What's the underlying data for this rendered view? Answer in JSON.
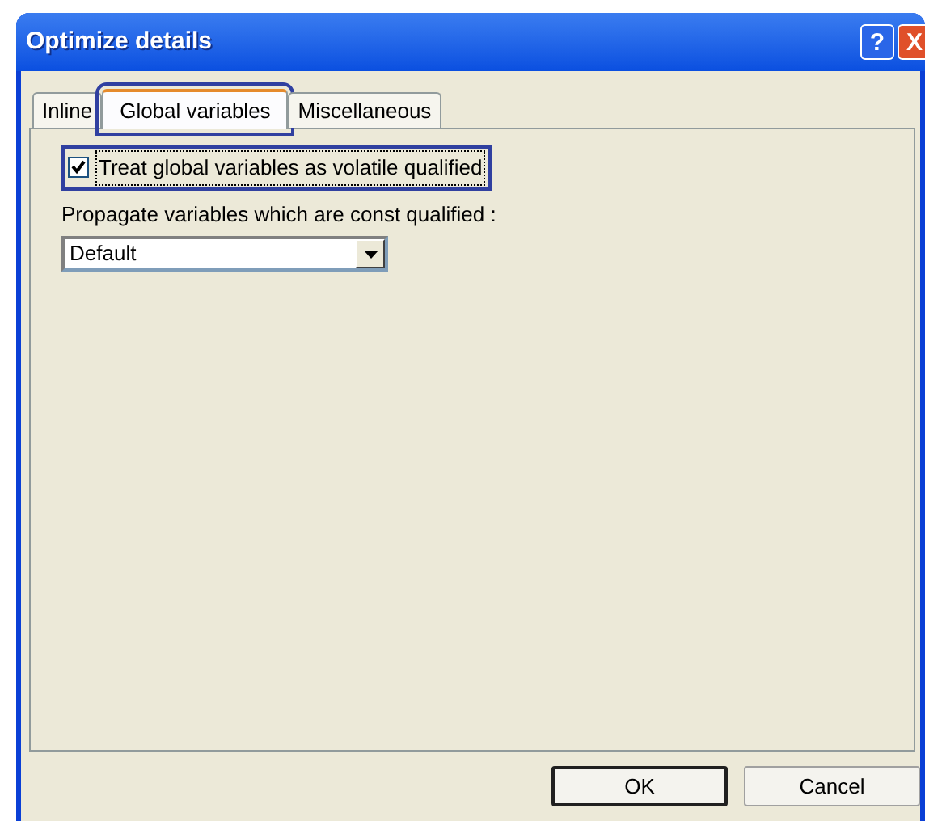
{
  "window": {
    "title": "Optimize details",
    "title_buttons": [
      "?",
      "X"
    ]
  },
  "tabs": [
    {
      "label": "Inline",
      "selected": false,
      "highlighted": false
    },
    {
      "label": "Global variables",
      "selected": true,
      "highlighted": true
    },
    {
      "label": "Miscellaneous",
      "selected": false,
      "highlighted": false
    }
  ],
  "options": {
    "checkbox": {
      "label": "Treat global variables as volatile qualified",
      "checked": true,
      "highlighted": true
    },
    "propagate": {
      "label": "Propagate variables which are const qualified :",
      "value": "Default"
    }
  },
  "buttons": [
    {
      "label": "OK",
      "default": true
    },
    {
      "label": "Cancel",
      "default": false
    }
  ]
}
